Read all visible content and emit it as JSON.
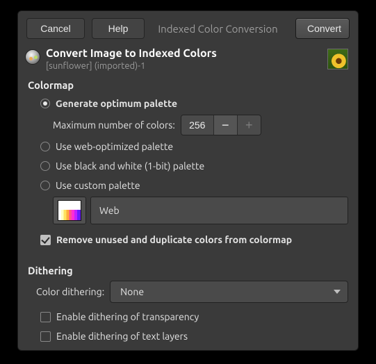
{
  "header": {
    "cancel": "Cancel",
    "help": "Help",
    "title": "Indexed Color Conversion",
    "convert": "Convert"
  },
  "subhead": {
    "title": "Convert Image to Indexed Colors",
    "subtitle": "[sunflower] (imported)-1"
  },
  "colormap": {
    "section_title": "Colormap",
    "options": {
      "generate": "Generate optimum palette",
      "max_label": "Maximum number of colors:",
      "max_value": "256",
      "web": "Use web-optimized palette",
      "bw": "Use black and white (1-bit) palette",
      "custom": "Use custom palette",
      "custom_palette_name": "Web"
    },
    "selected": "generate",
    "remove_dup_label": "Remove unused and duplicate colors from colormap",
    "remove_dup_checked": true
  },
  "dithering": {
    "section_title": "Dithering",
    "color_dithering_label": "Color dithering:",
    "color_dithering_value": "None",
    "enable_transparency": "Enable dithering of transparency",
    "enable_transparency_checked": false,
    "enable_text": "Enable dithering of text layers",
    "enable_text_checked": false
  }
}
